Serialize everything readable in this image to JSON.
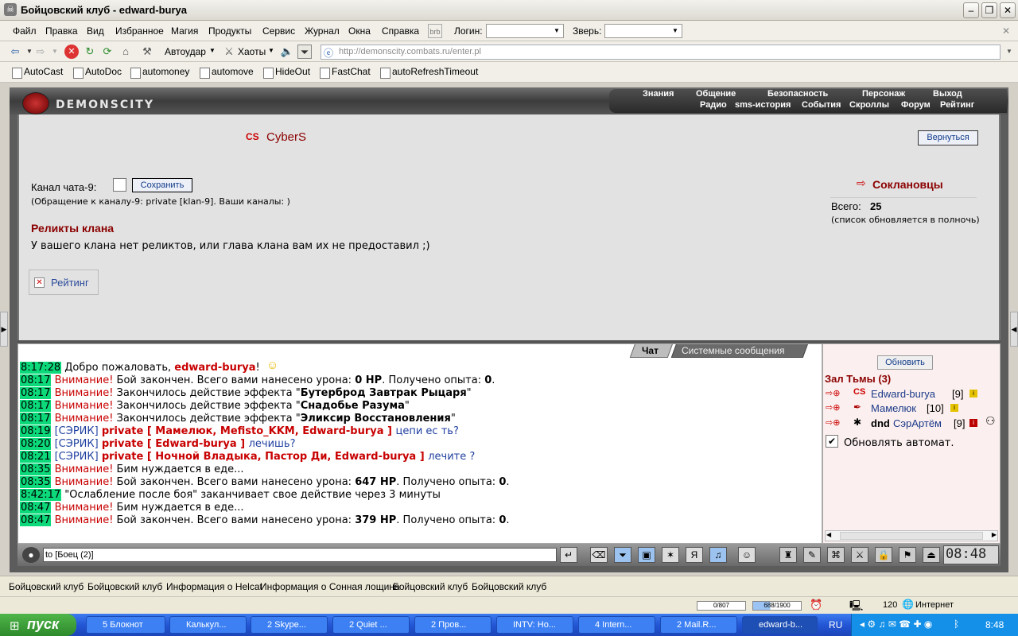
{
  "window": {
    "title": "Бойцовский клуб - edward-burya"
  },
  "menu": {
    "items": [
      "Файл",
      "Правка",
      "Вид",
      "Избранное",
      "Магия",
      "Продукты",
      "Сервис",
      "Журнал",
      "Окна",
      "Справка"
    ],
    "login_label": "Логин:",
    "pet_label": "Зверь:"
  },
  "nav": {
    "autoudar": "Автоудар",
    "haoty": "Хаоты",
    "url": "http://demonscity.combats.ru/enter.pl"
  },
  "links": [
    "AutoCast",
    "AutoDoc",
    "automoney",
    "automove",
    "HideOut",
    "FastChat",
    "autoRefreshTimeout"
  ],
  "game": {
    "logo": "DEMONSCITY",
    "top_nav": [
      "Знания",
      "Общение",
      "Безопасность",
      "Персонаж",
      "Выход"
    ],
    "sub_nav": [
      "Радио",
      "sms-история",
      "События",
      "Скроллы",
      "Форум",
      "Рейтинг"
    ],
    "clan_tag": "CS",
    "clan_name": "CyberS",
    "back_button": "Вернуться",
    "chat_channel_label": "Канал чата-9:",
    "save_button": "Сохранить",
    "channel_hint": "(Обращение к каналу-9: private [klan-9]. Ваши каналы: )",
    "relics_title": "Реликты клана",
    "relics_text": "У вашего клана нет реликтов, или глава клана вам их не предоставил ;)",
    "rating": "Рейтинг",
    "clanmates_title": "Соклановцы",
    "total_label": "Всего:",
    "total_value": "25",
    "list_note": "(список обновляется в полночь)",
    "chat_tabs": [
      "Чат",
      "Системные сообщения"
    ],
    "refresh_button": "Обновить",
    "room": "Зал Тьмы (3)",
    "users": [
      {
        "name": "Edward-burya",
        "level": "[9]",
        "prefix": ""
      },
      {
        "name": "Мамелюк",
        "level": "[10]",
        "prefix": ""
      },
      {
        "name": "СэрАртём",
        "level": "[9]",
        "prefix": "dnd "
      }
    ],
    "auto_refresh_label": "Обновлять автомат.",
    "input_value": "to [Боец (2)]",
    "clock": "08:48"
  },
  "chat": [
    {
      "t": "8:17:28",
      "parts": [
        {
          "c": "",
          "x": "Добро пожаловать, "
        },
        {
          "c": "red",
          "x": "edward-burya"
        },
        {
          "c": "",
          "x": "!"
        }
      ]
    },
    {
      "t": "08:17",
      "parts": [
        {
          "c": "warn",
          "x": "Внимание! "
        },
        {
          "c": "",
          "x": "Бой закончен. Всего вами нанесено урона: "
        },
        {
          "c": "bold",
          "x": "0 HP"
        },
        {
          "c": "",
          "x": ". Получено опыта: "
        },
        {
          "c": "bold",
          "x": "0"
        },
        {
          "c": "",
          "x": "."
        }
      ]
    },
    {
      "t": "08:17",
      "parts": [
        {
          "c": "warn",
          "x": "Внимание! "
        },
        {
          "c": "",
          "x": "Закончилось действие эффекта \""
        },
        {
          "c": "bold",
          "x": "Бутерброд Завтрак Рыцаря"
        },
        {
          "c": "",
          "x": "\""
        }
      ]
    },
    {
      "t": "08:17",
      "parts": [
        {
          "c": "warn",
          "x": "Внимание! "
        },
        {
          "c": "",
          "x": "Закончилось действие эффекта \""
        },
        {
          "c": "bold",
          "x": "Снадобье Разума"
        },
        {
          "c": "",
          "x": "\""
        }
      ]
    },
    {
      "t": "08:17",
      "parts": [
        {
          "c": "warn",
          "x": "Внимание! "
        },
        {
          "c": "",
          "x": "Закончилось действие эффекта \""
        },
        {
          "c": "bold",
          "x": "Эликсир Восстановления"
        },
        {
          "c": "",
          "x": "\""
        }
      ]
    },
    {
      "t": "08:19",
      "parts": [
        {
          "c": "blue",
          "x": "[СЭРИК] "
        },
        {
          "c": "red",
          "x": "private [ Мамелюк, Mefisto_KKM, Edward-burya ] "
        },
        {
          "c": "blue",
          "x": "цепи ес ть?"
        }
      ]
    },
    {
      "t": "08:20",
      "parts": [
        {
          "c": "blue",
          "x": "[СЭРИК] "
        },
        {
          "c": "red",
          "x": "private [ Edward-burya ] "
        },
        {
          "c": "blue",
          "x": "лечишь?"
        }
      ]
    },
    {
      "t": "08:21",
      "parts": [
        {
          "c": "blue",
          "x": "[СЭРИК] "
        },
        {
          "c": "red",
          "x": "private [ Ночной Владыка, Пастор Ди, Edward-burya ] "
        },
        {
          "c": "blue",
          "x": "лечите ?"
        }
      ]
    },
    {
      "t": "08:35",
      "parts": [
        {
          "c": "warn",
          "x": "Внимание! "
        },
        {
          "c": "",
          "x": "Бим нуждается в еде..."
        }
      ]
    },
    {
      "t": "08:35",
      "parts": [
        {
          "c": "warn",
          "x": "Внимание! "
        },
        {
          "c": "",
          "x": "Бой закончен. Всего вами нанесено урона: "
        },
        {
          "c": "bold",
          "x": "647 HP"
        },
        {
          "c": "",
          "x": ". Получено опыта: "
        },
        {
          "c": "bold",
          "x": "0"
        },
        {
          "c": "",
          "x": "."
        }
      ]
    },
    {
      "t": "8:42:17",
      "parts": [
        {
          "c": "",
          "x": "\"Ослабление после боя\" заканчивает свое действие через 3 минуты"
        }
      ]
    },
    {
      "t": "08:47",
      "parts": [
        {
          "c": "warn",
          "x": "Внимание! "
        },
        {
          "c": "",
          "x": "Бим нуждается в еде..."
        }
      ]
    },
    {
      "t": "08:47",
      "parts": [
        {
          "c": "warn",
          "x": "Внимание! "
        },
        {
          "c": "",
          "x": "Бой закончен. Всего вами нанесено урона: "
        },
        {
          "c": "bold",
          "x": "379 HP"
        },
        {
          "c": "",
          "x": ". Получено опыта: "
        },
        {
          "c": "bold",
          "x": "0"
        },
        {
          "c": "",
          "x": "."
        }
      ]
    }
  ],
  "tabs": [
    "Бойцовский клуб",
    "Бойцовский клуб",
    "Информация о Helcat",
    "Информация о Сонная лощина",
    "Бойцовский клуб",
    "Бойцовский клуб"
  ],
  "status": {
    "hp": "0/807",
    "mana": "688/1900",
    "zone_num": "120",
    "zone": "Интернет"
  },
  "taskbar": {
    "start": "пуск",
    "tasks": [
      "5 Блокнот",
      "Калькул...",
      "2 Skype...",
      "2 Quiet ...",
      "2 Пров...",
      "INTV: Но...",
      "4 Intern...",
      "2 Mail.R...",
      "edward-b..."
    ],
    "lang": "RU",
    "time": "8:48"
  }
}
